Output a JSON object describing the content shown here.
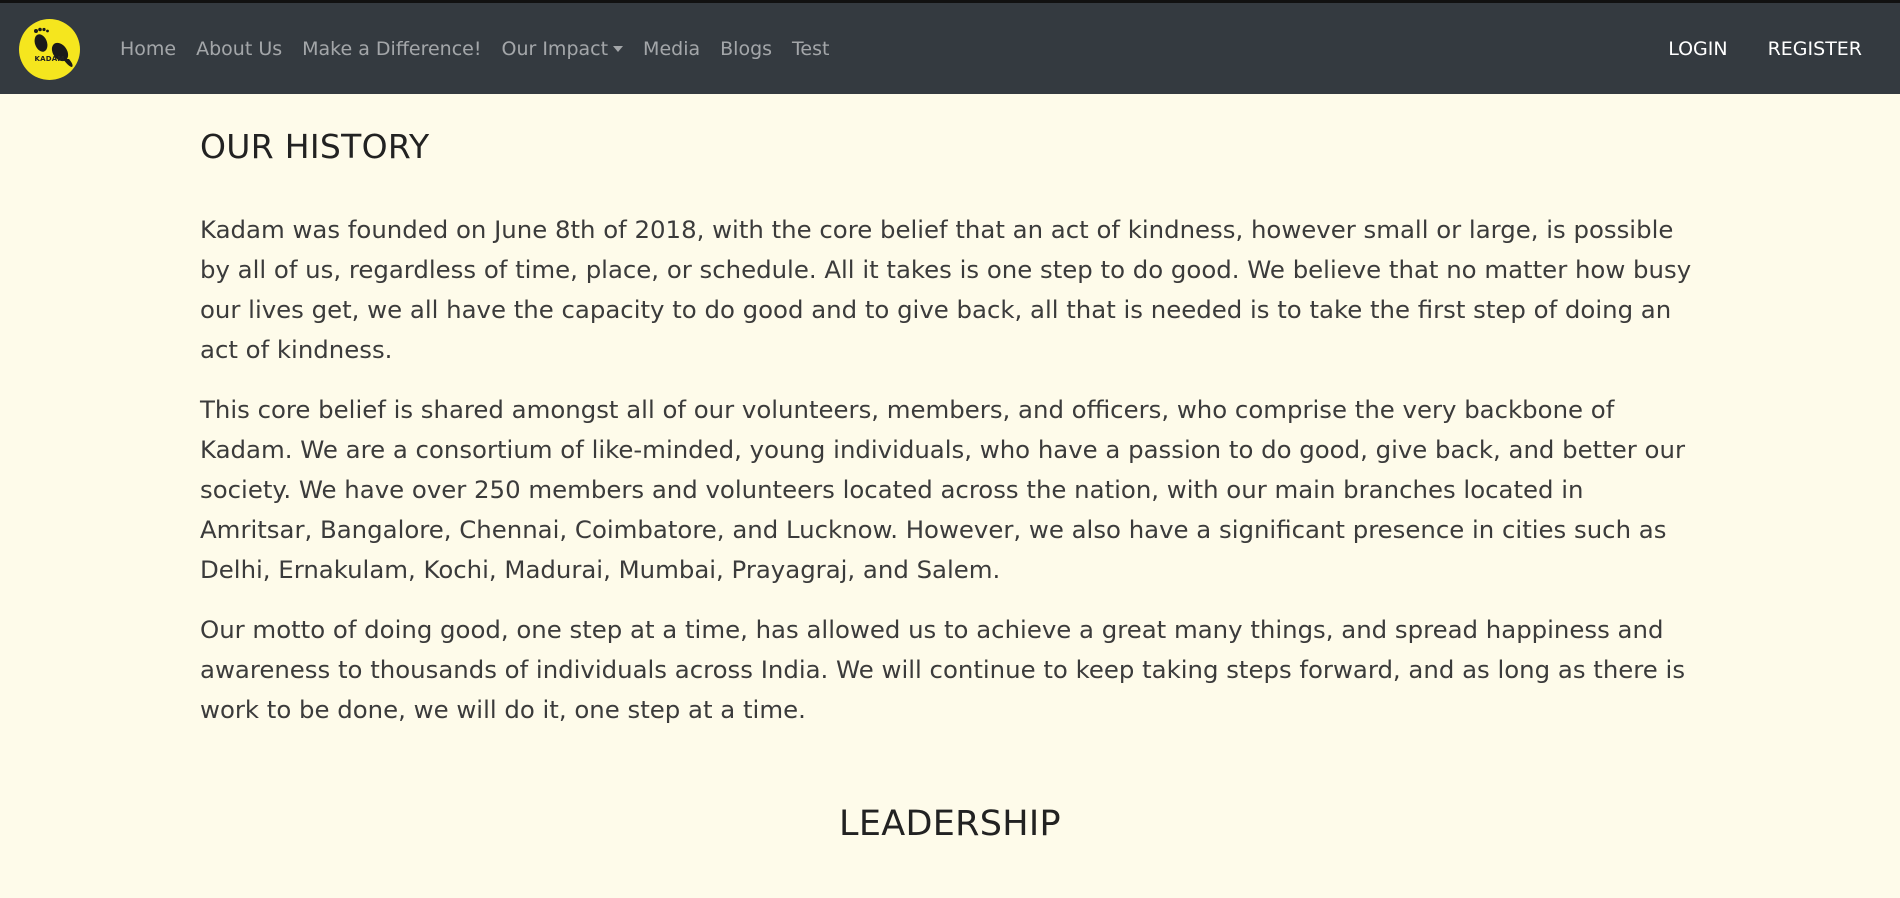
{
  "brand": {
    "name": "KADAM",
    "logo_icon": "footprints-icon",
    "logo_color": "#f5e61e"
  },
  "nav": {
    "links": [
      {
        "label": "Home"
      },
      {
        "label": "About Us"
      },
      {
        "label": "Make a Difference!"
      },
      {
        "label": "Our Impact"
      },
      {
        "label": "Media"
      },
      {
        "label": "Blogs"
      },
      {
        "label": "Test"
      }
    ],
    "login": "LOGIN",
    "register": "REGISTER",
    "background": "#343a40"
  },
  "history": {
    "title": "OUR HISTORY",
    "paragraphs": [
      "Kadam was founded on June 8th of 2018, with the core belief that an act of kindness, however small or large, is possible by all of us, regardless of time, place, or schedule. All it takes is one step to do good. We believe that no matter how busy our lives get, we all have the capacity to do good and to give back, all that is needed is to take the first step of doing an act of kindness.",
      "This core belief is shared amongst all of our volunteers, members, and officers, who comprise the very backbone of Kadam. We are a consortium of like-minded, young individuals, who have a passion to do good, give back, and better our society. We have over 250 members and volunteers located across the nation, with our main branches located in Amritsar, Bangalore, Chennai, Coimbatore, and Lucknow. However, we also have a significant presence in cities such as Delhi, Ernakulam, Kochi, Madurai, Mumbai, Prayagraj, and Salem.",
      "Our motto of doing good, one step at a time, has allowed us to achieve a great many things, and spread happiness and awareness to thousands of individuals across India. We will continue to keep taking steps forward, and as long as there is work to be done, we will do it, one step at a time."
    ]
  },
  "leadership": {
    "title": "LEADERSHIP"
  },
  "page_background": "#fefbea"
}
